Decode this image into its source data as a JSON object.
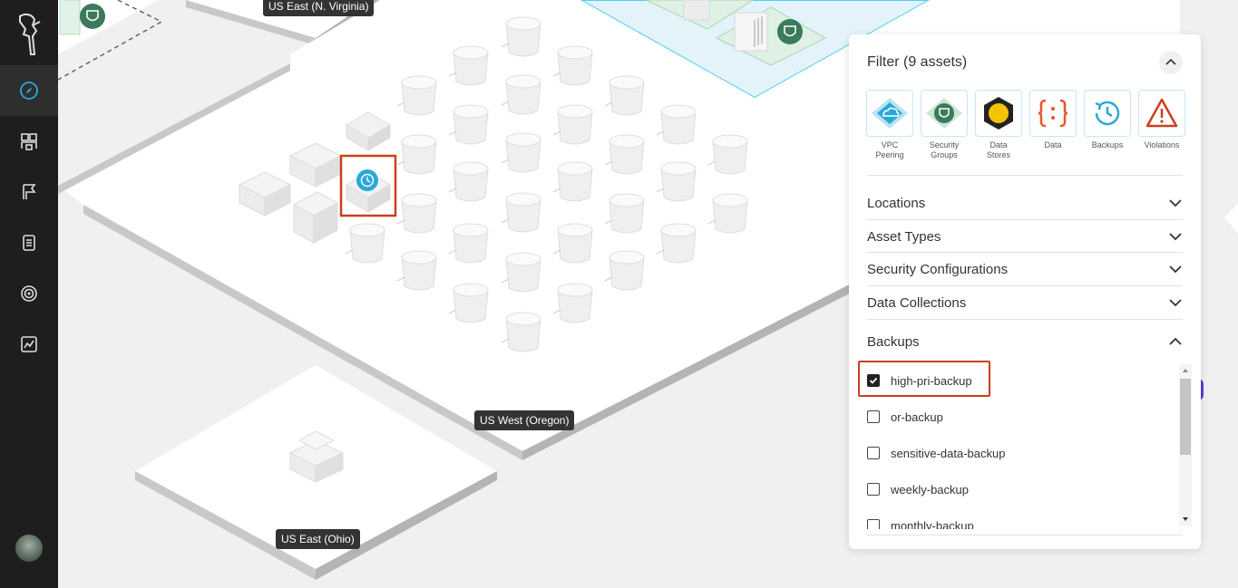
{
  "sidebar": {
    "items": [
      {
        "name": "explore",
        "icon": "compass-icon",
        "active": true
      },
      {
        "name": "inventory",
        "icon": "inventory-icon",
        "active": false
      },
      {
        "name": "reports",
        "icon": "flag-icon",
        "active": false
      },
      {
        "name": "documents",
        "icon": "document-icon",
        "active": false
      },
      {
        "name": "targets",
        "icon": "target-icon",
        "active": false
      },
      {
        "name": "analytics",
        "icon": "chart-icon",
        "active": false
      }
    ]
  },
  "map": {
    "regions": [
      {
        "label": "US East (N. Virginia)"
      },
      {
        "label": "US West (Oregon)"
      },
      {
        "label": "US East (Ohio)"
      }
    ]
  },
  "filter_panel": {
    "title": "Filter (9 assets)",
    "asset_types": [
      {
        "label_line1": "VPC",
        "label_line2": "Peering",
        "icon": "vpc-peering-icon",
        "color": "#29a9d8"
      },
      {
        "label_line1": "Security",
        "label_line2": "Groups",
        "icon": "security-group-icon",
        "color": "#3b7a5a"
      },
      {
        "label_line1": "Data",
        "label_line2": "Stores",
        "icon": "data-store-icon",
        "color": "#f5c400"
      },
      {
        "label_line1": "Data",
        "label_line2": "",
        "icon": "data-braces-icon",
        "color": "#e8572a"
      },
      {
        "label_line1": "Backups",
        "label_line2": "",
        "icon": "backup-clock-icon",
        "color": "#29a9d8"
      },
      {
        "label_line1": "Violations",
        "label_line2": "",
        "icon": "warning-icon",
        "color": "#c9401c"
      }
    ],
    "sections": [
      {
        "label": "Locations",
        "expanded": false
      },
      {
        "label": "Asset Types",
        "expanded": false
      },
      {
        "label": "Security Configurations",
        "expanded": false
      },
      {
        "label": "Data Collections",
        "expanded": false
      },
      {
        "label": "Backups",
        "expanded": true
      }
    ],
    "backups": [
      {
        "label": "high-pri-backup",
        "checked": true
      },
      {
        "label": "or-backup",
        "checked": false
      },
      {
        "label": "sensitive-data-backup",
        "checked": false
      },
      {
        "label": "weekly-backup",
        "checked": false
      },
      {
        "label": "monthly-backup",
        "checked": false
      }
    ]
  },
  "colors": {
    "accent": "#29a9d8",
    "highlight": "#c9401c",
    "sidebar": "#1e1e1e"
  }
}
